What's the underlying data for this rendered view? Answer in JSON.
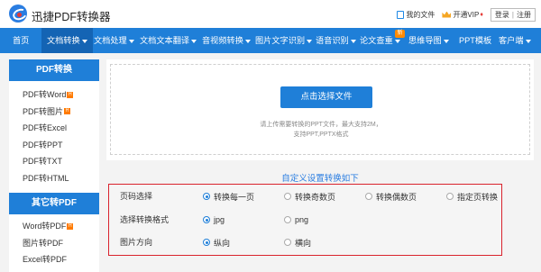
{
  "header": {
    "brand": "迅捷PDF转换器",
    "my_files": "我的文件",
    "vip_label": "开通VIP",
    "vip_tag": "♦",
    "login": "登录",
    "divider": "|",
    "register": "注册"
  },
  "nav": {
    "items": [
      {
        "label": "首页"
      },
      {
        "label": "文档转换"
      },
      {
        "label": "文档处理"
      },
      {
        "label": "文档文本翻译"
      },
      {
        "label": "音视频转换"
      },
      {
        "label": "图片文字识别"
      },
      {
        "label": "语音识别"
      },
      {
        "label": "论文查重"
      },
      {
        "label": "思维导图"
      },
      {
        "label": "PPT模板"
      },
      {
        "label": "客户端"
      }
    ],
    "new_badge": "新"
  },
  "sidebar": {
    "section1_title": "PDF转换",
    "section1_items": [
      {
        "label": "PDF转Word",
        "badge": "H"
      },
      {
        "label": "PDF转图片",
        "badge": "H"
      },
      {
        "label": "PDF转Excel"
      },
      {
        "label": "PDF转PPT"
      },
      {
        "label": "PDF转TXT"
      },
      {
        "label": "PDF转HTML"
      }
    ],
    "section2_title": "其它转PDF",
    "section2_items": [
      {
        "label": "Word转PDF",
        "badge": "H"
      },
      {
        "label": "图片转PDF"
      },
      {
        "label": "Excel转PDF"
      }
    ]
  },
  "upload": {
    "button_label": "点击选择文件",
    "hint_line1": "请上传需要转换的PPT文件，最大支持2M，",
    "hint_line2": "支持PPT,PPTX格式"
  },
  "settings": {
    "title": "自定义设置转换如下",
    "rows": [
      {
        "label": "页码选择",
        "options": [
          {
            "label": "转换每一页",
            "checked": true
          },
          {
            "label": "转换奇数页",
            "checked": false
          },
          {
            "label": "转换偶数页",
            "checked": false
          },
          {
            "label": "指定页转换",
            "checked": false
          }
        ]
      },
      {
        "label": "选择转换格式",
        "options": [
          {
            "label": "jpg",
            "checked": true
          },
          {
            "label": "png",
            "checked": false
          }
        ]
      },
      {
        "label": "图片方向",
        "options": [
          {
            "label": "纵向",
            "checked": true
          },
          {
            "label": "横向",
            "checked": false
          }
        ]
      }
    ]
  },
  "colors": {
    "accent": "#1f7fd8",
    "highlight_border": "#d9232d",
    "badge": "#ff7a00"
  }
}
